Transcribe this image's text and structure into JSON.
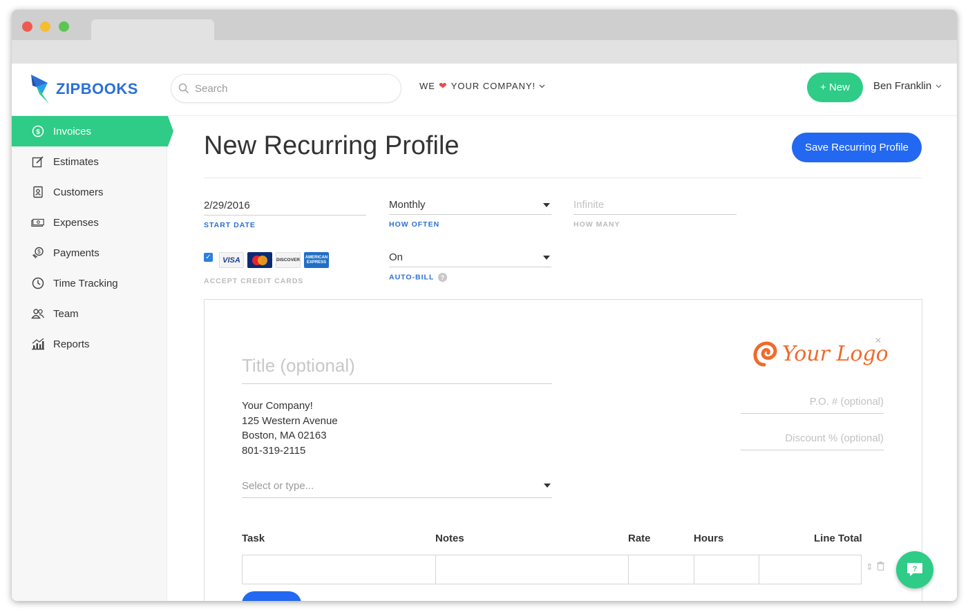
{
  "brand": {
    "name": "ZIPBOOKS"
  },
  "search": {
    "placeholder": "Search"
  },
  "company_menu": {
    "prefix": "WE",
    "label": "YOUR COMPANY!"
  },
  "header": {
    "new_label": "+ New",
    "user_name": "Ben Franklin"
  },
  "sidebar": {
    "items": [
      {
        "label": "Invoices",
        "icon": "dollar-circle-icon",
        "active": true
      },
      {
        "label": "Estimates",
        "icon": "edit-icon"
      },
      {
        "label": "Customers",
        "icon": "contact-card-icon"
      },
      {
        "label": "Expenses",
        "icon": "money-stack-icon"
      },
      {
        "label": "Payments",
        "icon": "payment-icon"
      },
      {
        "label": "Time Tracking",
        "icon": "clock-icon"
      },
      {
        "label": "Team",
        "icon": "people-icon"
      },
      {
        "label": "Reports",
        "icon": "chart-icon"
      }
    ]
  },
  "page": {
    "title": "New Recurring Profile",
    "save_label": "Save Recurring Profile"
  },
  "form": {
    "start_date": {
      "value": "2/29/2016",
      "label": "START DATE"
    },
    "how_often": {
      "value": "Monthly",
      "label": "HOW OFTEN"
    },
    "how_many": {
      "placeholder": "Infinite",
      "label": "HOW MANY"
    },
    "credit_cards": {
      "label": "ACCEPT CREDIT CARDS",
      "checked": true,
      "cards": [
        "VISA",
        "MasterCard",
        "DISCOVER",
        "AMERICAN EXPRESS"
      ]
    },
    "auto_bill": {
      "value": "On",
      "label": "AUTO-BILL"
    }
  },
  "invoice": {
    "title_placeholder": "Title (optional)",
    "address": [
      "Your Company!",
      "125 Western Avenue",
      "Boston, MA 02163",
      "801-319-2115"
    ],
    "client_placeholder": "Select or type...",
    "logo_text": "Your Logo",
    "po_placeholder": "P.O. # (optional)",
    "discount_placeholder": "Discount % (optional)",
    "columns": [
      "Task",
      "Notes",
      "Rate",
      "Hours",
      "Line Total"
    ]
  },
  "colors": {
    "accent_green": "#2ecc87",
    "accent_blue": "#2368f0",
    "label_blue": "#2b6fd6",
    "logo_orange": "#f06a2c"
  }
}
